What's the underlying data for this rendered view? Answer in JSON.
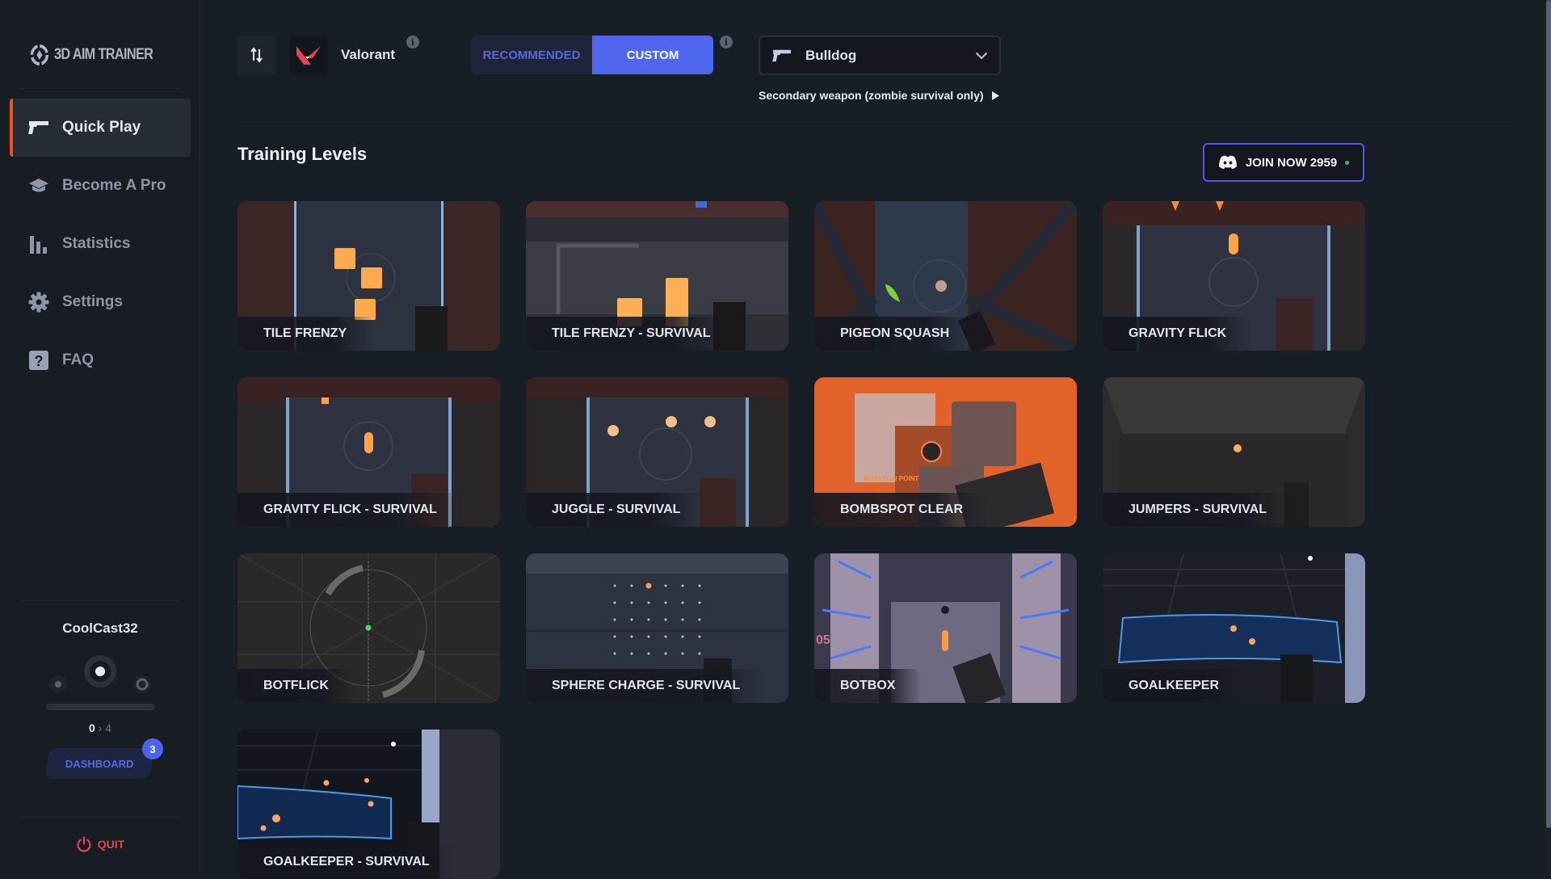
{
  "app": {
    "logo_text": "3D AIM TRAINER"
  },
  "sidebar": {
    "items": [
      {
        "label": "Quick Play",
        "icon": "pistol-icon",
        "active": true
      },
      {
        "label": "Become A Pro",
        "icon": "graduation-cap-icon",
        "active": false
      },
      {
        "label": "Statistics",
        "icon": "bar-chart-icon",
        "active": false
      },
      {
        "label": "Settings",
        "icon": "gear-icon",
        "active": false
      },
      {
        "label": "FAQ",
        "icon": "question-icon",
        "active": false
      }
    ],
    "user": {
      "username": "CoolCast32",
      "rank_current": "0",
      "rank_separator": "›",
      "rank_next": "4",
      "progress": 0
    },
    "dashboard_label": "DASHBOARD",
    "dashboard_badge": "3",
    "quit_label": "QUIT"
  },
  "header": {
    "game_name": "Valorant",
    "mode_toggle": {
      "options": [
        "RECOMMENDED",
        "CUSTOM"
      ],
      "selected": "CUSTOM"
    },
    "weapon_select": {
      "value": "Bulldog"
    },
    "secondary_weapon_link": "Secondary weapon (zombie survival only)"
  },
  "section": {
    "title": "Training Levels",
    "discord_button": {
      "label": "JOIN NOW 2959",
      "status_color": "#20c17a"
    }
  },
  "levels": [
    {
      "name": "TILE FRENZY",
      "theme": "tile-frenzy"
    },
    {
      "name": "TILE FRENZY - SURVIVAL",
      "theme": "tile-survival"
    },
    {
      "name": "PIGEON SQUASH",
      "theme": "pigeon"
    },
    {
      "name": "GRAVITY FLICK",
      "theme": "gravity"
    },
    {
      "name": "GRAVITY FLICK - SURVIVAL",
      "theme": "gravity2"
    },
    {
      "name": "JUGGLE - SURVIVAL",
      "theme": "juggle"
    },
    {
      "name": "BOMBSPOT CLEAR",
      "theme": "bombspot"
    },
    {
      "name": "JUMPERS - SURVIVAL",
      "theme": "jumpers"
    },
    {
      "name": "BOTFLICK",
      "theme": "botflick"
    },
    {
      "name": "SPHERE CHARGE - SURVIVAL",
      "theme": "sphere"
    },
    {
      "name": "BOTBOX",
      "theme": "botbox"
    },
    {
      "name": "GOALKEEPER",
      "theme": "goalkeeper"
    },
    {
      "name": "GOALKEEPER - SURVIVAL",
      "theme": "goalkeeper2"
    }
  ],
  "colors": {
    "accent": "#4f66ef",
    "active_indicator": "#f0521b",
    "quit": "#d94a52",
    "target_orange": "#ffad4a"
  }
}
